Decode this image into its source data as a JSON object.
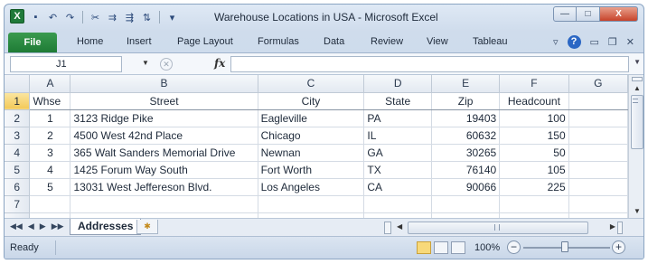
{
  "window": {
    "title": "Warehouse Locations in USA  -  Microsoft Excel",
    "app_icon_letter": "X",
    "min_glyph": "—",
    "max_glyph": "□",
    "close_glyph": "X"
  },
  "quick_access": [
    {
      "icon": "save-icon",
      "glyph": "▪"
    },
    {
      "icon": "undo-icon",
      "glyph": "↶"
    },
    {
      "icon": "redo-icon",
      "glyph": "↷"
    },
    {
      "icon": "cut-icon",
      "glyph": "✂"
    },
    {
      "icon": "format-painter-icon",
      "glyph": "⇉"
    },
    {
      "icon": "insert-row-icon",
      "glyph": "⇶"
    },
    {
      "icon": "sort-icon",
      "glyph": "⇅"
    },
    {
      "icon": "customize-icon",
      "glyph": "▾"
    }
  ],
  "ribbon": {
    "file_label": "File",
    "tabs": [
      "Home",
      "Insert",
      "Page Layout",
      "Formulas",
      "Data",
      "Review",
      "View",
      "Tableau"
    ],
    "right_glyphs": {
      "minimize_ribbon": "▿",
      "help": "?",
      "restore": "▭",
      "window": "❐",
      "close": "✕"
    }
  },
  "formula_bar": {
    "name_box": "J1",
    "name_box_arrow": "▼",
    "cancel_glyph": "✕",
    "fx_label": "fx",
    "formula_value": "",
    "expand_glyph": "▼"
  },
  "grid": {
    "columns": [
      "A",
      "B",
      "C",
      "D",
      "E",
      "F",
      "G"
    ],
    "rows": [
      {
        "num": "1",
        "cells": [
          "Whse",
          "Street",
          "City",
          "State",
          "Zip",
          "Headcount",
          ""
        ]
      },
      {
        "num": "2",
        "cells": [
          "1",
          "3123 Ridge Pike",
          "Eagleville",
          "PA",
          "19403",
          "100",
          ""
        ]
      },
      {
        "num": "3",
        "cells": [
          "2",
          "4500 West 42nd Place",
          "Chicago",
          "IL",
          "60632",
          "150",
          ""
        ]
      },
      {
        "num": "4",
        "cells": [
          "3",
          "365 Walt Sanders Memorial Drive",
          "Newnan",
          "GA",
          "30265",
          "50",
          ""
        ]
      },
      {
        "num": "5",
        "cells": [
          "4",
          "1425 Forum Way South",
          "Fort Worth",
          "TX",
          "76140",
          "105",
          ""
        ]
      },
      {
        "num": "6",
        "cells": [
          "5",
          "13031 West Jeffereson Blvd.",
          "Los Angeles",
          "CA",
          "90066",
          "225",
          ""
        ]
      },
      {
        "num": "7",
        "cells": [
          "",
          "",
          "",
          "",
          "",
          "",
          ""
        ]
      }
    ]
  },
  "scroll": {
    "up": "▲",
    "down": "▼",
    "left": "◀",
    "right": "▶"
  },
  "sheets": {
    "nav": [
      "◀◀",
      "◀",
      "▶",
      "▶▶"
    ],
    "active": "Addresses",
    "new_glyph": "✱"
  },
  "status": {
    "mode": "Ready",
    "zoom": "100%",
    "zoom_minus": "−",
    "zoom_plus": "+"
  }
}
